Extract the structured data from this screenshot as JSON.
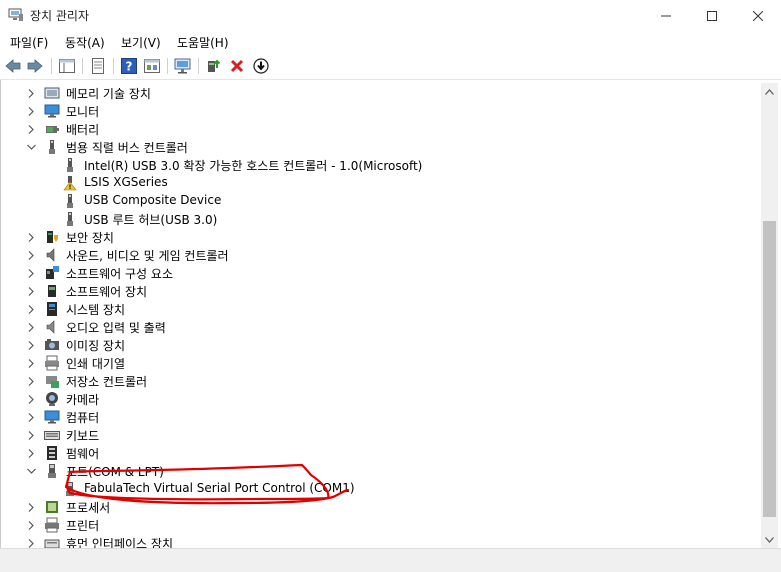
{
  "window": {
    "title": "장치 관리자"
  },
  "menu": [
    {
      "label": "파일(F)"
    },
    {
      "label": "동작(A)"
    },
    {
      "label": "보기(V)"
    },
    {
      "label": "도움말(H)"
    }
  ],
  "toolbar": {
    "buttons": [
      "back-icon",
      "forward-icon",
      "properties-icon",
      "device-list-icon",
      "help-icon",
      "view-icon",
      "monitor-icon",
      "update-driver-icon",
      "uninstall-icon",
      "disable-icon"
    ]
  },
  "tree": {
    "top_partial_label": "",
    "items": [
      {
        "label": "메모리 기술 장치",
        "expanded": false,
        "level": 0,
        "icon": "memory-device-icon"
      },
      {
        "label": "모니터",
        "expanded": false,
        "level": 0,
        "icon": "monitor-icon"
      },
      {
        "label": "배터리",
        "expanded": false,
        "level": 0,
        "icon": "battery-icon"
      },
      {
        "label": "범용 직렬 버스 컨트롤러",
        "expanded": true,
        "level": 0,
        "icon": "usb-icon"
      },
      {
        "label": "Intel(R) USB 3.0 확장 가능한 호스트 컨트롤러 - 1.0(Microsoft)",
        "level": 1,
        "icon": "usb-icon"
      },
      {
        "label": "LSIS XGSeries",
        "level": 1,
        "icon": "usb-warning-icon"
      },
      {
        "label": "USB Composite Device",
        "level": 1,
        "icon": "usb-icon"
      },
      {
        "label": "USB 루트 허브(USB 3.0)",
        "level": 1,
        "icon": "usb-icon"
      },
      {
        "label": "보안 장치",
        "expanded": false,
        "level": 0,
        "icon": "security-device-icon"
      },
      {
        "label": "사운드, 비디오 및 게임 컨트롤러",
        "expanded": false,
        "level": 0,
        "icon": "sound-icon"
      },
      {
        "label": "소프트웨어 구성 요소",
        "expanded": false,
        "level": 0,
        "icon": "software-component-icon"
      },
      {
        "label": "소프트웨어 장치",
        "expanded": false,
        "level": 0,
        "icon": "software-device-icon"
      },
      {
        "label": "시스템 장치",
        "expanded": false,
        "level": 0,
        "icon": "system-device-icon"
      },
      {
        "label": "오디오 입력 및 출력",
        "expanded": false,
        "level": 0,
        "icon": "audio-icon"
      },
      {
        "label": "이미징 장치",
        "expanded": false,
        "level": 0,
        "icon": "imaging-icon"
      },
      {
        "label": "인쇄 대기열",
        "expanded": false,
        "level": 0,
        "icon": "print-queue-icon"
      },
      {
        "label": "저장소 컨트롤러",
        "expanded": false,
        "level": 0,
        "icon": "storage-controller-icon"
      },
      {
        "label": "카메라",
        "expanded": false,
        "level": 0,
        "icon": "camera-icon"
      },
      {
        "label": "컴퓨터",
        "expanded": false,
        "level": 0,
        "icon": "computer-icon"
      },
      {
        "label": "키보드",
        "expanded": false,
        "level": 0,
        "icon": "keyboard-icon"
      },
      {
        "label": "펌웨어",
        "expanded": false,
        "level": 0,
        "icon": "firmware-icon"
      },
      {
        "label": "포트(COM & LPT)",
        "expanded": true,
        "level": 0,
        "icon": "port-icon"
      },
      {
        "label": "FabulaTech Virtual Serial Port Control (COM1)",
        "level": 1,
        "icon": "port-icon"
      },
      {
        "label": "프로세서",
        "expanded": false,
        "level": 0,
        "icon": "processor-icon"
      },
      {
        "label": "프린터",
        "expanded": false,
        "level": 0,
        "icon": "printer-icon"
      },
      {
        "label": "휴먼 인터페이스 장치",
        "expanded": false,
        "level": 0,
        "icon": "hid-icon"
      }
    ]
  },
  "annotation": {
    "color": "#e00000"
  }
}
